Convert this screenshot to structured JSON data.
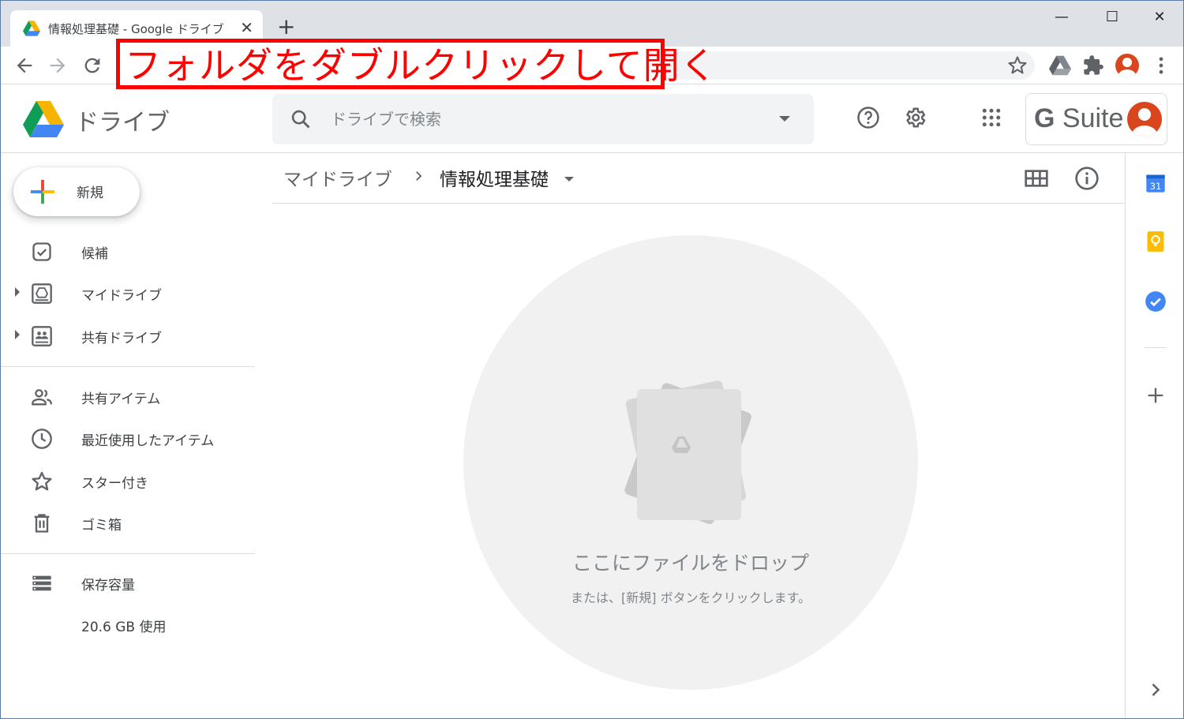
{
  "browser": {
    "tab_title": "情報処理基礎 - Google ドライブ",
    "tab_close": "✕",
    "new_tab": "+",
    "window_controls": {
      "minimize": "—",
      "maximize": "☐",
      "close": "✕"
    }
  },
  "annotation": {
    "text": "フォルダをダブルクリックして開く",
    "color": "#ff0000"
  },
  "drive": {
    "app_name": "ドライブ",
    "search": {
      "placeholder": "ドライブで検索"
    },
    "gsuite_label": "Suite",
    "gsuite_g": "G"
  },
  "sidebar": {
    "new_label": "新規",
    "items": [
      {
        "label": "候補",
        "icon": "suggested-icon"
      },
      {
        "label": "マイドライブ",
        "icon": "my-drive-icon"
      },
      {
        "label": "共有ドライブ",
        "icon": "shared-drives-icon"
      },
      {
        "label": "共有アイテム",
        "icon": "shared-with-me-icon"
      },
      {
        "label": "最近使用したアイテム",
        "icon": "clock-icon"
      },
      {
        "label": "スター付き",
        "icon": "star-icon"
      },
      {
        "label": "ゴミ箱",
        "icon": "trash-icon"
      },
      {
        "label": "保存容量",
        "icon": "storage-icon"
      }
    ],
    "storage_used": "20.6 GB 使用"
  },
  "main": {
    "breadcrumb_root": "マイドライブ",
    "breadcrumb_current": "情報処理基礎",
    "empty_title": "ここにファイルをドロップ",
    "empty_subtitle": "または、[新規] ボタンをクリックします。"
  },
  "side_panel": {
    "calendar_day": "31"
  },
  "colors": {
    "drive_green": "#0f9d58",
    "drive_yellow": "#f4b400",
    "drive_blue": "#4285f4",
    "avatar": "#d9461e"
  }
}
